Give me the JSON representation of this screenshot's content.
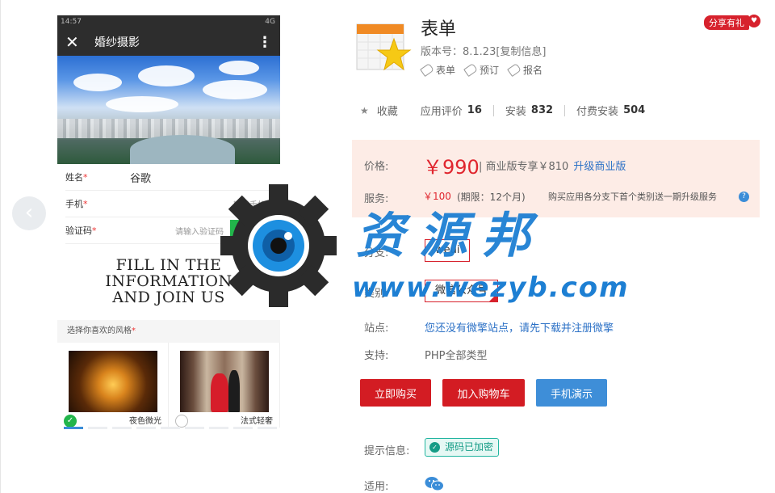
{
  "phone": {
    "status_time": "14:57",
    "status_right": "4G",
    "nav_title": "婚纱摄影",
    "form": {
      "name_label": "姓名",
      "name_value": "谷歌",
      "phone_label": "手机",
      "phone_placeholder": "输入手机",
      "code_label": "验证码",
      "code_placeholder": "请输入验证码",
      "code_button": "获取验证码"
    },
    "slogan_line1": "FILL IN THE INFORMATION",
    "slogan_line2": "AND JOIN US",
    "style_title": "选择你喜欢的风格",
    "styles": [
      {
        "name": "夜色微光",
        "checked": true
      },
      {
        "name": "法式轻奢",
        "checked": false
      }
    ],
    "carousel_pages": 9,
    "carousel_active": 0
  },
  "watermark": {
    "text": "资源邦",
    "url": "www.wezyb.com"
  },
  "app": {
    "name": "表单",
    "version": "版本号：8.1.23[复制信息]",
    "share": "分享有礼",
    "tags": [
      "表单",
      "预订",
      "报名"
    ],
    "favorite": "收藏",
    "rating_label": "应用评价",
    "rating_value": "16",
    "installs_label": "安装",
    "installs_value": "832",
    "paid_label": "付费安装",
    "paid_value": "504"
  },
  "pricing": {
    "price_label": "价格:",
    "price": "￥990",
    "business_note": "| 商业版专享￥810",
    "upgrade_link": "升级商业版",
    "service_label": "服务:",
    "service_price": "￥100",
    "service_term": "(期限：12个月)",
    "service_note": "购买应用各分支下首个类别送一期升级服务"
  },
  "options": {
    "branch_label": "分支:",
    "branch_value": "weui",
    "category_label": "类别:",
    "category_value": "微信公众号",
    "site_label": "站点:",
    "site_value": "您还没有微擎站点，请先下载并注册微擎",
    "support_label": "支持:",
    "support_value": "PHP全部类型"
  },
  "actions": {
    "buy": "立即购买",
    "cart": "加入购物车",
    "demo": "手机演示"
  },
  "footer": {
    "hint_label": "提示信息:",
    "hint_badge": "源码已加密",
    "apply_label": "适用:"
  },
  "colors": {
    "accent_red": "#d31c23",
    "link_blue": "#2c71c6",
    "price_bg": "#fdece6",
    "watermark_blue": "#1d7fd3"
  }
}
